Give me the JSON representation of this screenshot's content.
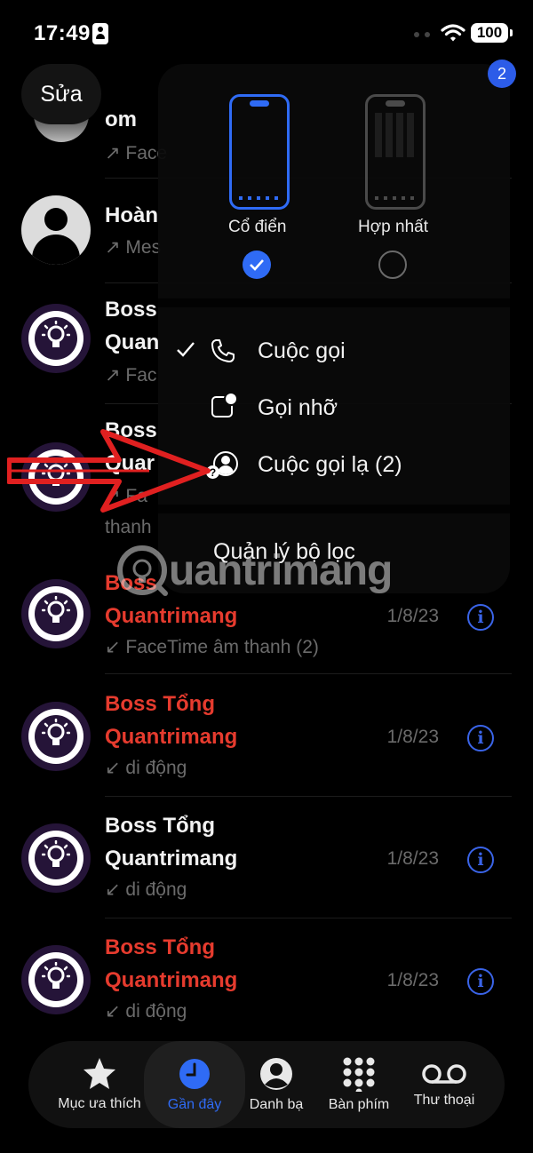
{
  "status_bar": {
    "time": "17:49",
    "battery": "100"
  },
  "badge": {
    "count": "2"
  },
  "toolbar": {
    "edit_label": "Sửa"
  },
  "popup": {
    "view_options": [
      {
        "label": "Cổ điển",
        "selected": true
      },
      {
        "label": "Hợp nhất",
        "selected": false
      }
    ],
    "filters": [
      {
        "label": "Cuộc gọi",
        "checked": true,
        "icon": "phone-icon"
      },
      {
        "label": "Gọi nhỡ",
        "checked": false,
        "icon": "missed-call-icon"
      },
      {
        "label": "Cuộc gọi lạ (2)",
        "checked": false,
        "icon": "unknown-caller-icon"
      }
    ],
    "manage_label": "Quản lý bộ lọc"
  },
  "calls": [
    {
      "name_line1": "",
      "name_line2": "om",
      "sub": "↗ Face",
      "date": "",
      "missed": false
    },
    {
      "name_line1": "Hoàn",
      "name_line2": "",
      "sub": "↗ Mes",
      "date": "",
      "missed": false
    },
    {
      "name_line1": "Boss",
      "name_line2": "Quan",
      "sub": "↗ Fac",
      "date": "",
      "missed": false
    },
    {
      "name_line1": "Boss",
      "name_line2": "Quar",
      "sub": "↗ Fa",
      "sub2": "thanh",
      "date": "",
      "missed": false
    },
    {
      "name_line1": "Boss",
      "name_line2": "Quantrimang",
      "sub": "↙ FaceTime âm thanh (2)",
      "date": "1/8/23",
      "missed": true
    },
    {
      "name_line1": "Boss Tổng",
      "name_line2": "Quantrimang",
      "sub": "↙ di động",
      "date": "1/8/23",
      "missed": true
    },
    {
      "name_line1": "Boss Tổng",
      "name_line2": "Quantrimang",
      "sub": "↙ di động",
      "date": "1/8/23",
      "missed": false
    },
    {
      "name_line1": "Boss Tổng",
      "name_line2": "Quantrimang",
      "sub": "↙ di động",
      "date": "1/8/23",
      "missed": true
    }
  ],
  "watermark": {
    "text": "uantrimang"
  },
  "tabs": [
    {
      "label": "Mục ưa thích",
      "icon": "star-icon",
      "active": false
    },
    {
      "label": "Gần đây",
      "icon": "clock-icon",
      "active": true
    },
    {
      "label": "Danh bạ",
      "icon": "contact-icon",
      "active": false
    },
    {
      "label": "Bàn phím",
      "icon": "keypad-icon",
      "active": false
    },
    {
      "label": "Thư thoại",
      "icon": "voicemail-icon",
      "active": false
    }
  ],
  "colors": {
    "accent": "#2f6bf5",
    "missed": "#e63b2e",
    "badge": "#2c5ce8",
    "arrow": "#e02020"
  }
}
